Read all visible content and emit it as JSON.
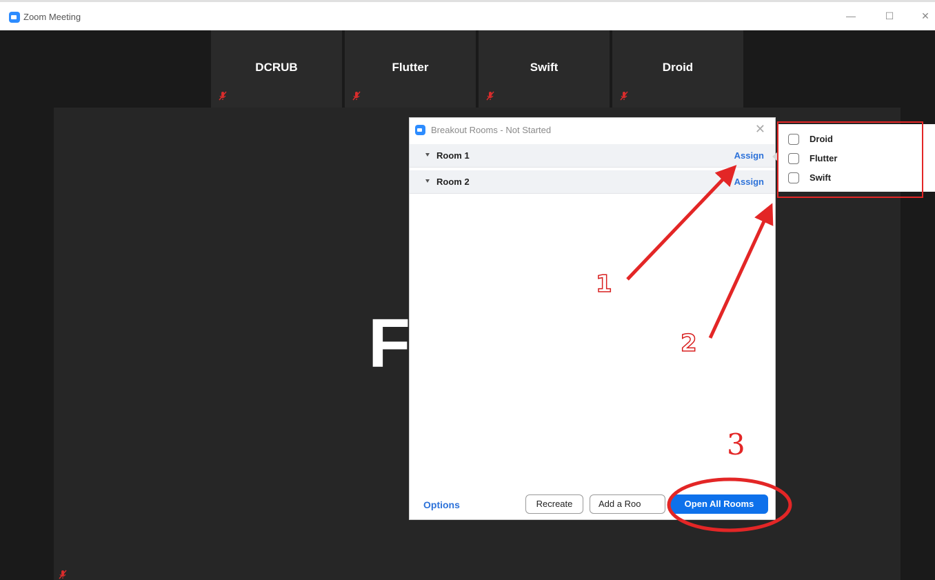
{
  "window": {
    "title": "Zoom Meeting",
    "controls": {
      "minimize": "—",
      "maximize": "☐",
      "close": "✕"
    }
  },
  "participants": [
    {
      "name": "DCRUB"
    },
    {
      "name": "Flutter"
    },
    {
      "name": "Swift"
    },
    {
      "name": "Droid"
    }
  ],
  "main_video": {
    "letter": "F"
  },
  "dialog": {
    "title": "Breakout Rooms - Not Started",
    "close": "✕",
    "rooms": [
      {
        "name": "Room 1",
        "assign": "Assign"
      },
      {
        "name": "Room 2",
        "assign": "Assign"
      }
    ],
    "options": "Options",
    "recreate": "Recreate",
    "add_room": "Add a Roo",
    "open_all": "Open All Rooms"
  },
  "assign_popup": {
    "items": [
      {
        "label": "Droid",
        "checked": false
      },
      {
        "label": "Flutter",
        "checked": false
      },
      {
        "label": "Swift",
        "checked": false
      }
    ]
  },
  "annotations": {
    "step1": "1",
    "step2": "2",
    "step3": "3"
  },
  "colors": {
    "accent": "#0e71eb",
    "link": "#2d72d9",
    "annotation": "#e32626"
  }
}
